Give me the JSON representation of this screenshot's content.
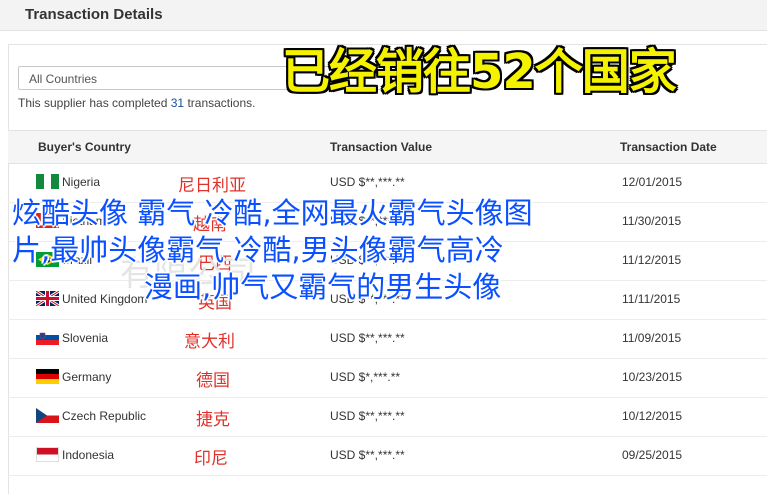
{
  "header": {
    "title": "Transaction Details"
  },
  "filter": {
    "selected": "All Countries"
  },
  "summary": {
    "prefix": "This supplier has completed ",
    "count": "31",
    "suffix": " transactions."
  },
  "banner": {
    "text": "已经销往52个国家"
  },
  "table": {
    "columns": [
      "Buyer's Country",
      "Transaction Value",
      "Transaction Date"
    ],
    "rows": [
      {
        "flag": "nigeria-flag",
        "country": "Nigeria",
        "zh": "尼日利亚",
        "value": "USD $**,***.**",
        "date": "12/01/2015"
      },
      {
        "flag": "vietnam-flag",
        "country": "Vietnam",
        "zh": "越南",
        "value": "USD $**,***.**",
        "date": "11/30/2015"
      },
      {
        "flag": "brazil-flag",
        "country": "Brazil",
        "zh": "巴西",
        "value": "USD $**,***.**",
        "date": "11/12/2015"
      },
      {
        "flag": "uk-flag",
        "country": "United Kingdom",
        "zh": "英国",
        "value": "USD $**,***.**",
        "date": "11/11/2015"
      },
      {
        "flag": "slovenia-flag",
        "country": "Slovenia",
        "zh": "意大利",
        "value": "USD $**,***.**",
        "date": "11/09/2015"
      },
      {
        "flag": "germany-flag",
        "country": "Germany",
        "zh": "德国",
        "value": "USD $*,***.**",
        "date": "10/23/2015"
      },
      {
        "flag": "czech-flag",
        "country": "Czech Republic",
        "zh": "捷克",
        "value": "USD $**,***.**",
        "date": "10/12/2015"
      },
      {
        "flag": "indonesia-flag",
        "country": "Indonesia",
        "zh": "印尼",
        "value": "USD $**,***.**",
        "date": "09/25/2015"
      }
    ]
  },
  "overlay": {
    "line1": "炫酷头像 霸气 冷酷,全网最火霸气头像图",
    "line2": "片,最帅头像霸气 冷酷,男头像霸气高冷",
    "line3": "漫画,帅气又霸气的男生头像"
  },
  "watermark": {
    "text": "有限公司"
  }
}
